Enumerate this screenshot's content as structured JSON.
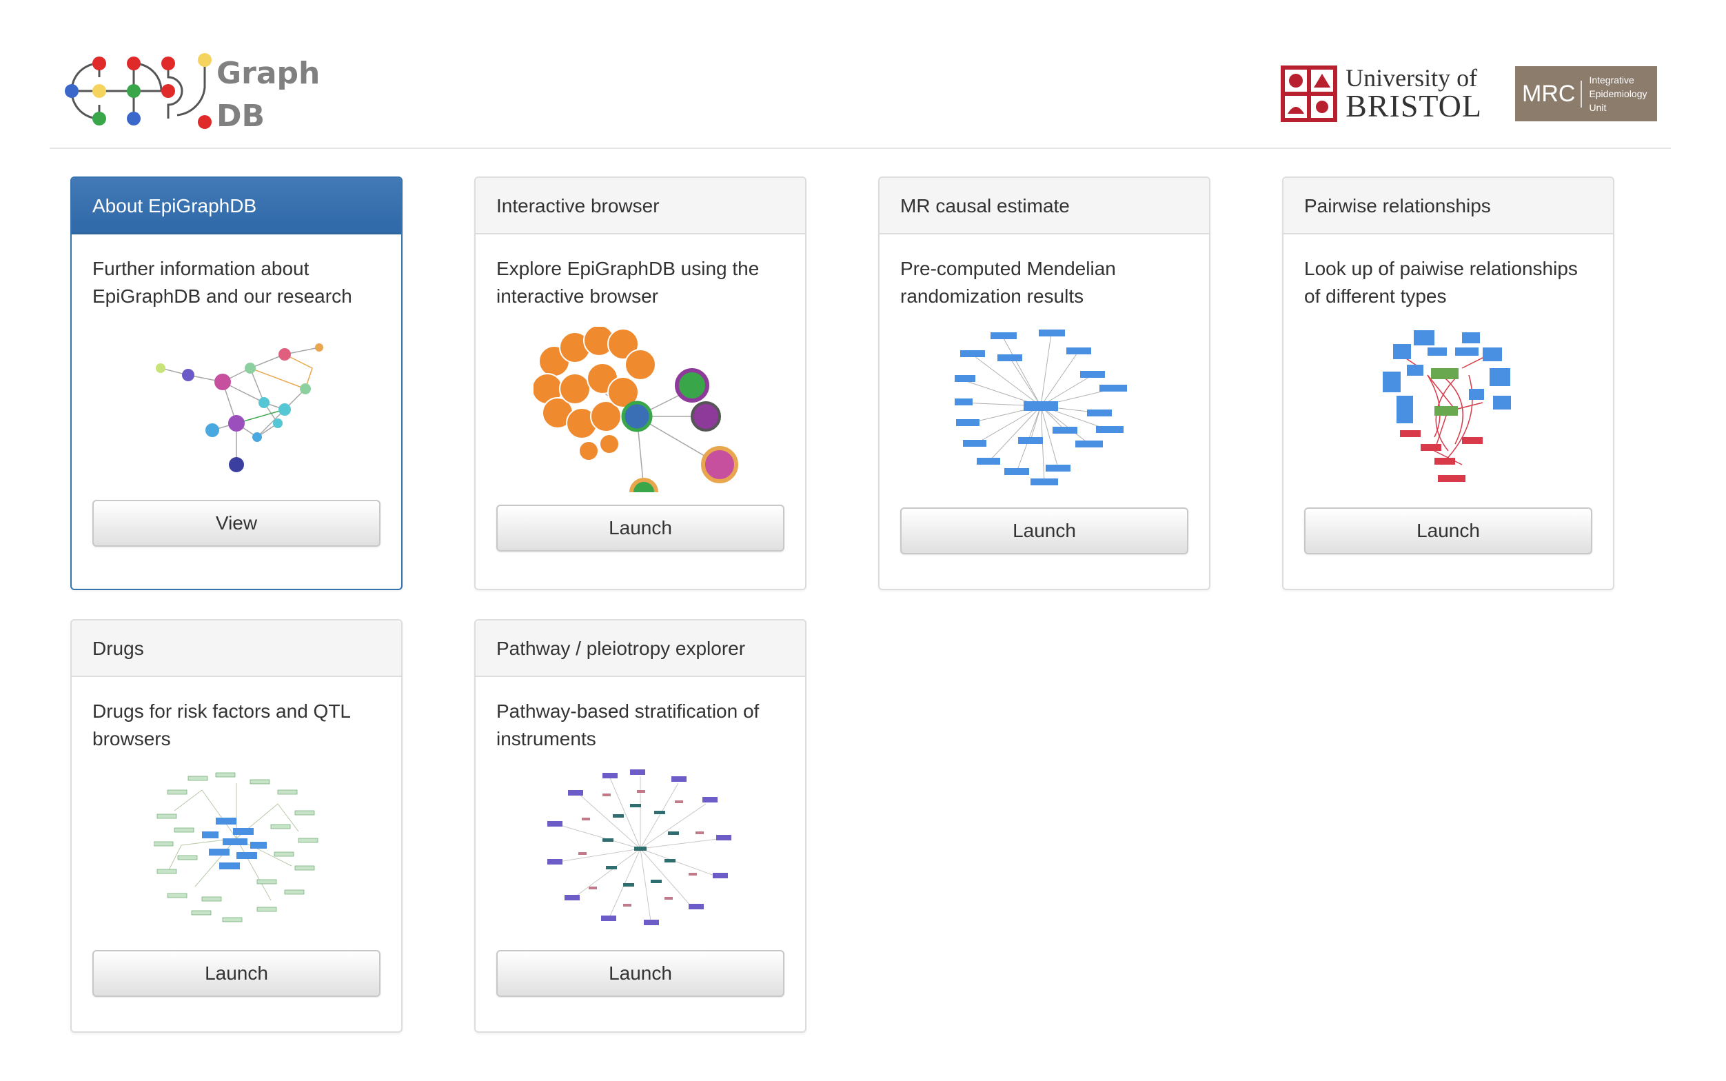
{
  "header": {
    "logo": {
      "name": "EpiGraphDB",
      "text_line1": "Graph",
      "text_line2": "DB"
    },
    "partners": [
      {
        "name": "University of Bristol",
        "line1": "University of",
        "line2": "BRISTOL"
      },
      {
        "name": "MRC Integrative Epidemiology Unit",
        "big": "MRC",
        "small_lines": [
          "Integrative",
          "Epidemiology",
          "Unit"
        ]
      }
    ]
  },
  "panels": [
    {
      "title": "About EpiGraphDB",
      "description": "Further information about EpiGraphDB and our research",
      "button": "View",
      "thumbnail": "network-graph-about"
    },
    {
      "title": "Interactive browser",
      "description": "Explore EpiGraphDB using the interactive browser",
      "button": "Launch",
      "thumbnail": "network-graph-browser"
    },
    {
      "title": "MR causal estimate",
      "description": "Pre-computed Mendelian randomization results",
      "button": "Launch",
      "thumbnail": "network-graph-mr"
    },
    {
      "title": "Pairwise relationships",
      "description": "Look up of paiwise relationships of different types",
      "button": "Launch",
      "thumbnail": "network-graph-pairwise"
    },
    {
      "title": "Drugs",
      "description": "Drugs for risk factors and QTL browsers",
      "button": "Launch",
      "thumbnail": "network-graph-drugs"
    },
    {
      "title": "Pathway / pleiotropy explorer",
      "description": "Pathway-based stratification of instruments",
      "button": "Launch",
      "thumbnail": "network-graph-pathway"
    }
  ],
  "colors": {
    "primary": "#3572b0",
    "logo_red": "#e02a2a",
    "logo_yellow": "#f4d35e",
    "logo_blue": "#3a67c9",
    "logo_green": "#3aa64a",
    "bristol_red": "#b81f2f",
    "mrc_brown": "#8c7c6c"
  }
}
